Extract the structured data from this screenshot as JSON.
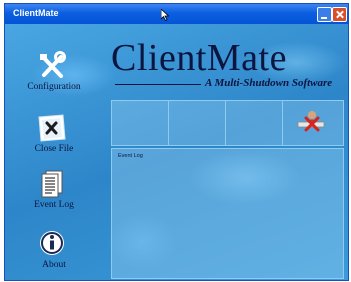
{
  "window": {
    "title": "ClientMate"
  },
  "logo": {
    "title": "ClientMate",
    "subtitle": "A Multi-Shutdown Software"
  },
  "sidebar": {
    "items": [
      {
        "label": "Configuration",
        "icon": "tools-icon"
      },
      {
        "label": "Close File",
        "icon": "close-file-icon"
      },
      {
        "label": "Event Log",
        "icon": "event-log-icon"
      },
      {
        "label": "About",
        "icon": "info-icon"
      }
    ]
  },
  "toolbar": {
    "action_icon": "shutdown-user-icon"
  },
  "event_log": {
    "title": "Event Log"
  },
  "colors": {
    "titlebar": "#0a5fe0",
    "background": "#2f87c8",
    "text_dark": "#0b1540",
    "panel_border": "#8ecbf0"
  }
}
